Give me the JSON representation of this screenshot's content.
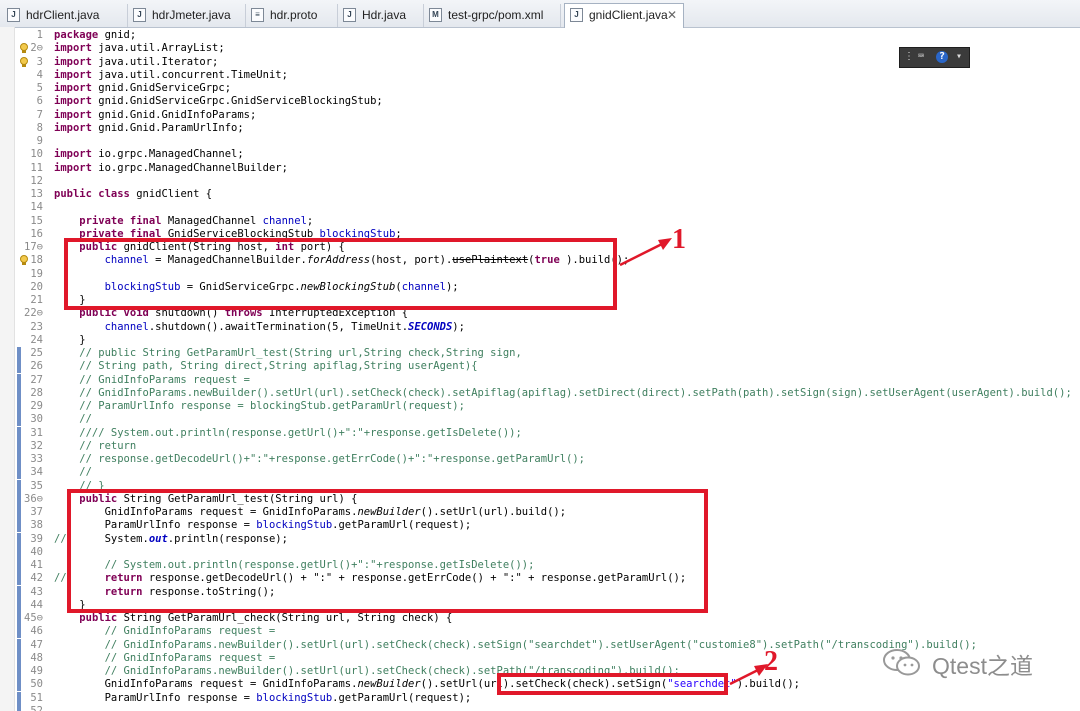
{
  "tabs": [
    {
      "label": "hdrClient.java",
      "icon": "java-file-icon"
    },
    {
      "label": "hdrJmeter.java",
      "icon": "java-file-icon"
    },
    {
      "label": "hdr.proto",
      "icon": "text-file-icon"
    },
    {
      "label": "Hdr.java",
      "icon": "java-file-icon"
    },
    {
      "label": "test-grpc/pom.xml",
      "icon": "maven-file-icon"
    },
    {
      "label": "gnidClient.java",
      "icon": "java-file-icon",
      "active": true
    }
  ],
  "close_glyph": "✕",
  "code_lines": [
    {
      "n": "1",
      "s": [
        [
          "kw",
          "package"
        ],
        [
          "",
          "gnid;"
        ]
      ]
    },
    {
      "n": "2⊖",
      "s": [
        [
          "kw",
          "import"
        ],
        [
          "",
          "java.util.ArrayList;"
        ]
      ]
    },
    {
      "n": "3",
      "s": [
        [
          "kw",
          "import"
        ],
        [
          "",
          "java.util.Iterator;"
        ]
      ]
    },
    {
      "n": "4",
      "s": [
        [
          "kw",
          "import"
        ],
        [
          "",
          "java.util.concurrent.TimeUnit;"
        ]
      ]
    },
    {
      "n": "5",
      "s": [
        [
          "kw",
          "import"
        ],
        [
          "",
          "gnid.GnidServiceGrpc;"
        ]
      ]
    },
    {
      "n": "6",
      "s": [
        [
          "kw",
          "import"
        ],
        [
          "",
          "gnid.GnidServiceGrpc.GnidServiceBlockingStub;"
        ]
      ]
    },
    {
      "n": "7",
      "s": [
        [
          "kw",
          "import"
        ],
        [
          "",
          "gnid.Gnid.GnidInfoParams;"
        ]
      ]
    },
    {
      "n": "8",
      "s": [
        [
          "kw",
          "import"
        ],
        [
          "",
          "gnid.Gnid.ParamUrlInfo;"
        ]
      ]
    },
    {
      "n": "9",
      "s": []
    },
    {
      "n": "10",
      "s": [
        [
          "kw",
          "import"
        ],
        [
          "",
          "io.grpc.ManagedChannel;"
        ]
      ]
    },
    {
      "n": "11",
      "s": [
        [
          "kw",
          "import"
        ],
        [
          "",
          "io.grpc.ManagedChannelBuilder;"
        ]
      ]
    },
    {
      "n": "12",
      "s": []
    },
    {
      "n": "13",
      "s": [
        [
          "kw",
          "public class"
        ],
        [
          "",
          "gnidClient {"
        ]
      ]
    },
    {
      "n": "14",
      "s": []
    },
    {
      "n": "15",
      "s": [
        [
          "",
          "    "
        ],
        [
          "kw",
          "private final"
        ],
        [
          "",
          "ManagedChannel "
        ],
        [
          "fld",
          "channel"
        ],
        [
          "",
          ";"
        ]
      ]
    },
    {
      "n": "16",
      "s": [
        [
          "",
          "    "
        ],
        [
          "kw",
          "private final"
        ],
        [
          "",
          "GnidServiceBlockingStub "
        ],
        [
          "fld",
          "blockingStub"
        ],
        [
          "",
          ";"
        ]
      ]
    },
    {
      "n": "17⊖",
      "s": [
        [
          "",
          "    "
        ],
        [
          "kw",
          "public"
        ],
        [
          "",
          "gnidClient(String host, "
        ],
        [
          "kw",
          "int"
        ],
        [
          "",
          "port) {"
        ]
      ]
    },
    {
      "n": "18",
      "s": [
        [
          "",
          "        "
        ],
        [
          "fld",
          "channel"
        ],
        [
          "",
          " = ManagedChannelBuilder."
        ],
        [
          "st",
          "forAddress"
        ],
        [
          "",
          "(host, port)."
        ],
        [
          "strike",
          "usePlaintext"
        ],
        [
          "",
          "("
        ],
        [
          "kw",
          "true"
        ],
        [
          "",
          ").build();"
        ]
      ]
    },
    {
      "n": "19",
      "s": []
    },
    {
      "n": "20",
      "s": [
        [
          "",
          "        "
        ],
        [
          "fld",
          "blockingStub"
        ],
        [
          "",
          " = GnidServiceGrpc."
        ],
        [
          "st",
          "newBlockingStub"
        ],
        [
          "",
          "("
        ],
        [
          "fld",
          "channel"
        ],
        [
          "",
          ");"
        ]
      ]
    },
    {
      "n": "21",
      "s": [
        [
          "",
          "    }"
        ]
      ]
    },
    {
      "n": "22⊖",
      "s": [
        [
          "",
          "    "
        ],
        [
          "kw",
          "public void"
        ],
        [
          "",
          "shutdown() "
        ],
        [
          "kw",
          "throws"
        ],
        [
          "",
          "InterruptedException {"
        ]
      ]
    },
    {
      "n": "23",
      "s": [
        [
          "",
          "        "
        ],
        [
          "fld",
          "channel"
        ],
        [
          "",
          ".shutdown().awaitTermination(5, TimeUnit."
        ],
        [
          "sfld",
          "SECONDS"
        ],
        [
          "",
          ");"
        ]
      ]
    },
    {
      "n": "24",
      "s": [
        [
          "",
          "    }"
        ]
      ]
    },
    {
      "n": "25",
      "s": [
        [
          "cm",
          "    // public String GetParamUrl_test(String url,String check,String sign,"
        ]
      ]
    },
    {
      "n": "26",
      "s": [
        [
          "cm",
          "    // String path, String direct,String apiflag,String userAgent){"
        ]
      ]
    },
    {
      "n": "27",
      "s": [
        [
          "cm",
          "    // GnidInfoParams request ="
        ]
      ]
    },
    {
      "n": "28",
      "s": [
        [
          "cm",
          "    // GnidInfoParams.newBuilder().setUrl(url).setCheck(check).setApiflag(apiflag).setDirect(direct).setPath(path).setSign(sign).setUserAgent(userAgent).build();"
        ]
      ]
    },
    {
      "n": "29",
      "s": [
        [
          "cm",
          "    // ParamUrlInfo response = blockingStub.getParamUrl(request);"
        ]
      ]
    },
    {
      "n": "30",
      "s": [
        [
          "cm",
          "    //"
        ]
      ]
    },
    {
      "n": "31",
      "s": [
        [
          "cm",
          "    //// System.out.println(response.getUrl()+\":\"+response.getIsDelete());"
        ]
      ]
    },
    {
      "n": "32",
      "s": [
        [
          "cm",
          "    // return"
        ]
      ]
    },
    {
      "n": "33",
      "s": [
        [
          "cm",
          "    // response.getDecodeUrl()+\":\"+response.getErrCode()+\":\"+response.getParamUrl();"
        ]
      ]
    },
    {
      "n": "34",
      "s": [
        [
          "cm",
          "    //"
        ]
      ]
    },
    {
      "n": "35",
      "s": [
        [
          "cm",
          "    // }"
        ]
      ]
    },
    {
      "n": "36⊖",
      "s": [
        [
          "",
          "    "
        ],
        [
          "kw",
          "public"
        ],
        [
          "",
          "String GetParamUrl_test(String url) {"
        ]
      ]
    },
    {
      "n": "37",
      "s": [
        [
          "",
          "        GnidInfoParams request = GnidInfoParams."
        ],
        [
          "st",
          "newBuilder"
        ],
        [
          "",
          "().setUrl(url).build();"
        ]
      ]
    },
    {
      "n": "38",
      "s": [
        [
          "",
          "        ParamUrlInfo response = "
        ],
        [
          "fld",
          "blockingStub"
        ],
        [
          "",
          ".getParamUrl(request);"
        ]
      ]
    },
    {
      "n": "39",
      "lc": "//",
      "s": [
        [
          "",
          "        System."
        ],
        [
          "sfld",
          "out"
        ],
        [
          "",
          ".println(response);"
        ]
      ]
    },
    {
      "n": "40",
      "s": []
    },
    {
      "n": "41",
      "s": [
        [
          "cm",
          "        // System.out.println(response.getUrl()+\":\"+response.getIsDelete());"
        ]
      ]
    },
    {
      "n": "42",
      "lc": "//",
      "s": [
        [
          "",
          "        "
        ],
        [
          "kw",
          "return"
        ],
        [
          "",
          "response.getDecodeUrl() + \":\" + response.getErrCode() + \":\" + response.getParamUrl();"
        ]
      ]
    },
    {
      "n": "43",
      "s": [
        [
          "",
          "        "
        ],
        [
          "kw",
          "return"
        ],
        [
          "",
          "response.toString();"
        ]
      ]
    },
    {
      "n": "44",
      "s": [
        [
          "",
          "    }"
        ]
      ]
    },
    {
      "n": "45⊖",
      "s": [
        [
          "",
          "    "
        ],
        [
          "kw",
          "public"
        ],
        [
          "",
          "String GetParamUrl_check(String url, String check) {"
        ]
      ]
    },
    {
      "n": "46",
      "s": [
        [
          "cm",
          "        // GnidInfoParams request ="
        ]
      ]
    },
    {
      "n": "47",
      "s": [
        [
          "cm",
          "        // GnidInfoParams.newBuilder().setUrl(url).setCheck(check).setSign(\"searchdet\").setUserAgent(\"customie8\").setPath(\"/transcoding\").build();"
        ]
      ]
    },
    {
      "n": "48",
      "s": [
        [
          "cm",
          "        // GnidInfoParams request ="
        ]
      ]
    },
    {
      "n": "49",
      "s": [
        [
          "cm",
          "        // GnidInfoParams.newBuilder().setUrl(url).setCheck(check).setPath(\"/transcoding\").build();"
        ]
      ]
    },
    {
      "n": "50",
      "s": [
        [
          "",
          "        GnidInfoParams request = GnidInfoParams."
        ],
        [
          "st",
          "newBuilder"
        ],
        [
          "",
          "().setUrl(url).setCheck(check).setSign("
        ],
        [
          "str",
          "\"searchdet\""
        ],
        [
          "",
          ").build();"
        ]
      ]
    },
    {
      "n": "51",
      "s": [
        [
          "",
          "        ParamUrlInfo response = "
        ],
        [
          "fld",
          "blockingStub"
        ],
        [
          "",
          ".getParamUrl(request);"
        ]
      ]
    },
    {
      "n": "52",
      "s": []
    }
  ],
  "markers": [
    "2",
    "3",
    "18"
  ],
  "change_bars": [
    "25",
    "26",
    "27",
    "28",
    "29",
    "30",
    "31",
    "32",
    "33",
    "34",
    "35",
    "36",
    "37",
    "38",
    "39",
    "40",
    "41",
    "42",
    "43",
    "44",
    "45",
    "46",
    "47",
    "48",
    "49",
    "50",
    "51",
    "52"
  ],
  "annotations": {
    "box1_label": "1",
    "box2_label": "2"
  },
  "toolbox": {
    "items": [
      "grip-icon",
      "keyboard-icon",
      "help-icon",
      "menu-icon"
    ]
  },
  "watermark": {
    "text": "Qtest之道"
  },
  "colors": {
    "annotation_red": "#e0182a",
    "keyword": "#7f0055",
    "comment": "#3f7f5f",
    "field": "#0000c0",
    "string": "#2a00ff"
  }
}
